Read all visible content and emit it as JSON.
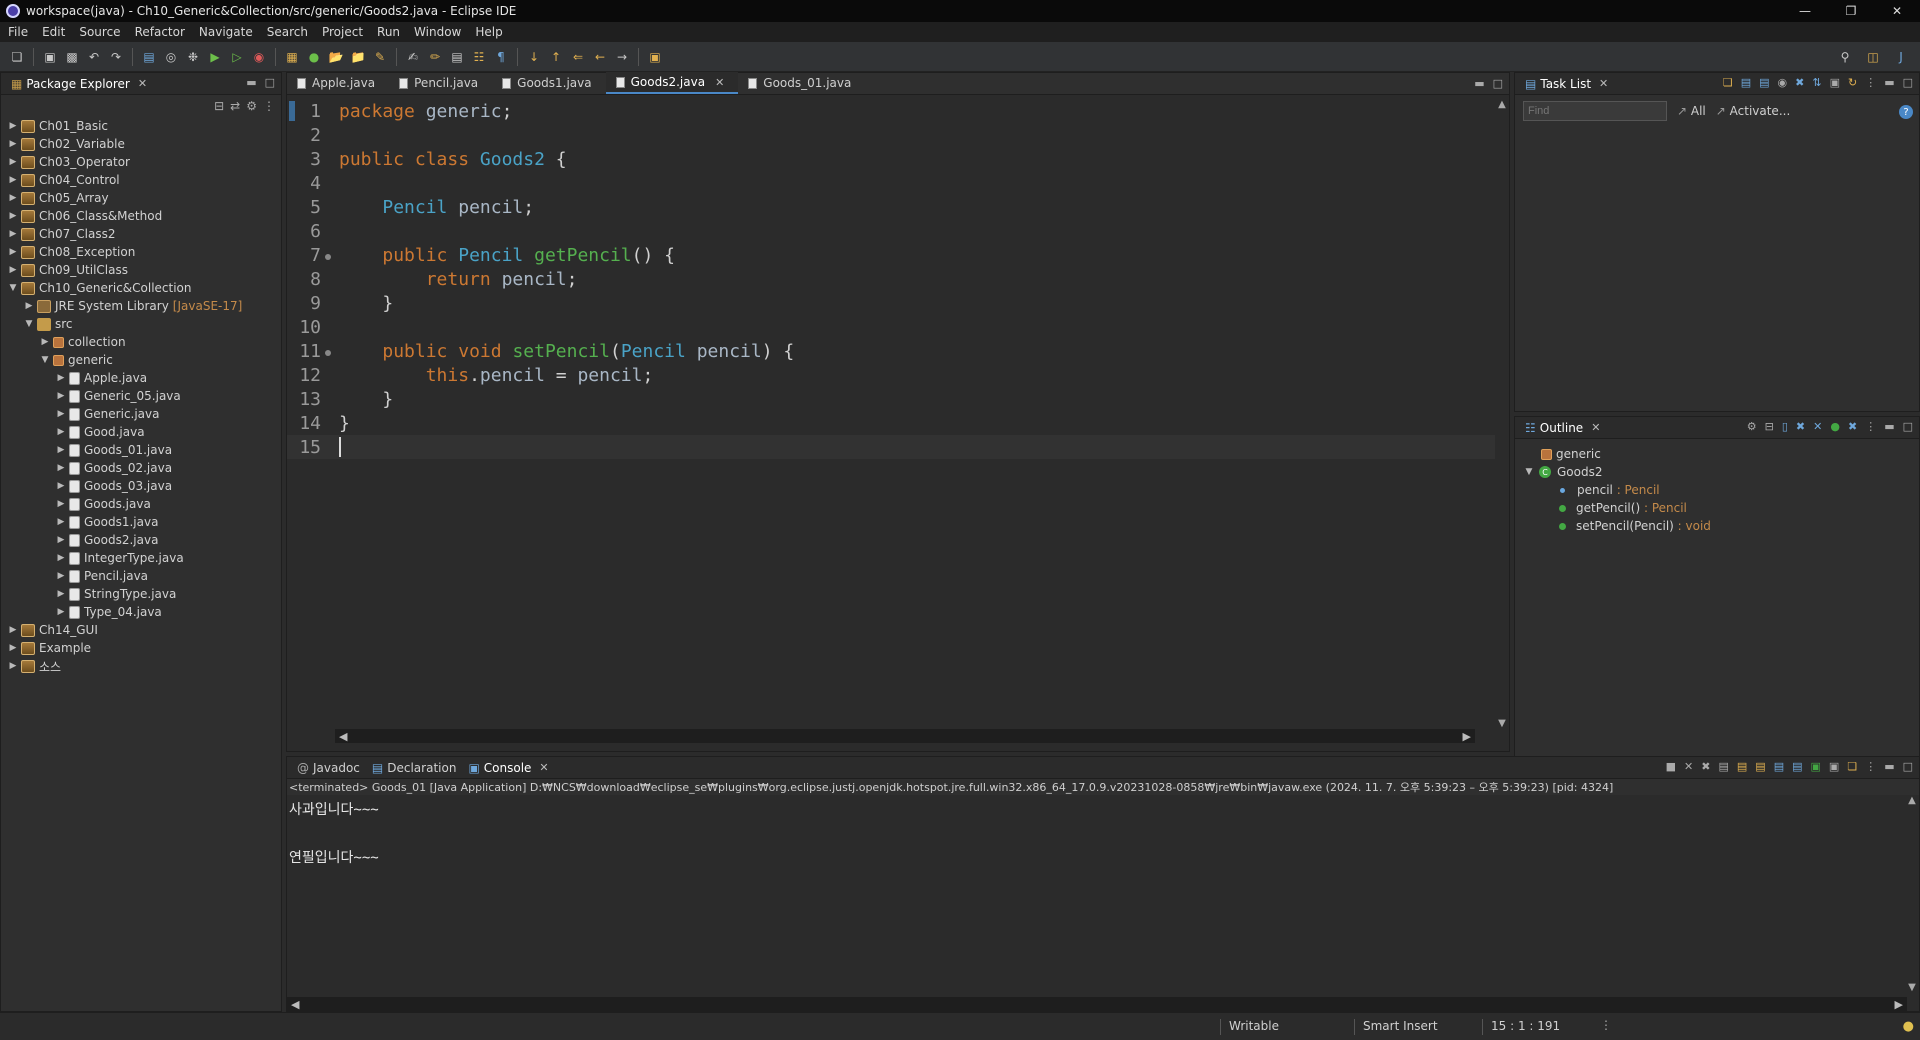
{
  "window": {
    "title": "workspace(java) - Ch10_Generic&Collection/src/generic/Goods2.java - Eclipse IDE"
  },
  "menu": [
    "File",
    "Edit",
    "Source",
    "Refactor",
    "Navigate",
    "Search",
    "Project",
    "Run",
    "Window",
    "Help"
  ],
  "package_explorer": {
    "title": "Package Explorer",
    "items": [
      {
        "label": "Ch01_Basic",
        "icon": "project",
        "depth": 0,
        "twisty": "closed"
      },
      {
        "label": "Ch02_Variable",
        "icon": "project",
        "depth": 0,
        "twisty": "closed"
      },
      {
        "label": "Ch03_Operator",
        "icon": "project",
        "depth": 0,
        "twisty": "closed"
      },
      {
        "label": "Ch04_Control",
        "icon": "project",
        "depth": 0,
        "twisty": "closed"
      },
      {
        "label": "Ch05_Array",
        "icon": "project",
        "depth": 0,
        "twisty": "closed"
      },
      {
        "label": "Ch06_Class&Method",
        "icon": "project",
        "depth": 0,
        "twisty": "closed"
      },
      {
        "label": "Ch07_Class2",
        "icon": "project",
        "depth": 0,
        "twisty": "closed"
      },
      {
        "label": "Ch08_Exception",
        "icon": "project",
        "depth": 0,
        "twisty": "closed"
      },
      {
        "label": "Ch09_UtilClass",
        "icon": "project",
        "depth": 0,
        "twisty": "closed"
      },
      {
        "label": "Ch10_Generic&Collection",
        "icon": "project",
        "depth": 0,
        "twisty": "open"
      },
      {
        "label": "JRE System Library",
        "tag": "[JavaSE-17]",
        "icon": "jre",
        "depth": 1,
        "twisty": "closed"
      },
      {
        "label": "src",
        "icon": "folder",
        "depth": 1,
        "twisty": "open"
      },
      {
        "label": "collection",
        "icon": "package",
        "depth": 2,
        "twisty": "closed"
      },
      {
        "label": "generic",
        "icon": "package",
        "depth": 2,
        "twisty": "open"
      },
      {
        "label": "Apple.java",
        "icon": "java",
        "depth": 3,
        "twisty": "closed"
      },
      {
        "label": "Generic_05.java",
        "icon": "java",
        "depth": 3,
        "twisty": "closed"
      },
      {
        "label": "Generic.java",
        "icon": "java",
        "depth": 3,
        "twisty": "closed"
      },
      {
        "label": "Good.java",
        "icon": "java",
        "depth": 3,
        "twisty": "closed"
      },
      {
        "label": "Goods_01.java",
        "icon": "java",
        "depth": 3,
        "twisty": "closed"
      },
      {
        "label": "Goods_02.java",
        "icon": "java",
        "depth": 3,
        "twisty": "closed"
      },
      {
        "label": "Goods_03.java",
        "icon": "java",
        "depth": 3,
        "twisty": "closed"
      },
      {
        "label": "Goods.java",
        "icon": "java",
        "depth": 3,
        "twisty": "closed"
      },
      {
        "label": "Goods1.java",
        "icon": "java",
        "depth": 3,
        "twisty": "closed"
      },
      {
        "label": "Goods2.java",
        "icon": "java",
        "depth": 3,
        "twisty": "closed"
      },
      {
        "label": "IntegerType.java",
        "icon": "java",
        "depth": 3,
        "twisty": "closed"
      },
      {
        "label": "Pencil.java",
        "icon": "java",
        "depth": 3,
        "twisty": "closed"
      },
      {
        "label": "StringType.java",
        "icon": "java",
        "depth": 3,
        "twisty": "closed"
      },
      {
        "label": "Type_04.java",
        "icon": "java",
        "depth": 3,
        "twisty": "closed"
      },
      {
        "label": "Ch14_GUI",
        "icon": "project",
        "depth": 0,
        "twisty": "closed"
      },
      {
        "label": "Example",
        "icon": "project",
        "depth": 0,
        "twisty": "closed"
      },
      {
        "label": "소스",
        "icon": "project",
        "depth": 0,
        "twisty": "closed"
      }
    ]
  },
  "editor": {
    "tabs": [
      {
        "label": "Apple.java",
        "active": false
      },
      {
        "label": "Pencil.java",
        "active": false
      },
      {
        "label": "Goods1.java",
        "active": false
      },
      {
        "label": "Goods2.java",
        "active": true
      },
      {
        "label": "Goods_01.java",
        "active": false
      }
    ],
    "lines": [
      [
        [
          "kw",
          "package"
        ],
        [
          "pl",
          " "
        ],
        [
          "id",
          "generic"
        ],
        [
          "pl",
          ";"
        ]
      ],
      [],
      [
        [
          "kw",
          "public"
        ],
        [
          "pl",
          " "
        ],
        [
          "kw",
          "class"
        ],
        [
          "pl",
          " "
        ],
        [
          "ty",
          "Goods2"
        ],
        [
          "pl",
          " {"
        ]
      ],
      [],
      [
        [
          "pl",
          "    "
        ],
        [
          "ty",
          "Pencil"
        ],
        [
          "pl",
          " "
        ],
        [
          "id",
          "pencil"
        ],
        [
          "pl",
          ";"
        ]
      ],
      [],
      [
        [
          "pl",
          "    "
        ],
        [
          "kw",
          "public"
        ],
        [
          "pl",
          " "
        ],
        [
          "ty",
          "Pencil"
        ],
        [
          "pl",
          " "
        ],
        [
          "fn",
          "getPencil"
        ],
        [
          "pl",
          "() {"
        ]
      ],
      [
        [
          "pl",
          "        "
        ],
        [
          "kw",
          "return"
        ],
        [
          "pl",
          " "
        ],
        [
          "id",
          "pencil"
        ],
        [
          "pl",
          ";"
        ]
      ],
      [
        [
          "pl",
          "    }"
        ]
      ],
      [],
      [
        [
          "pl",
          "    "
        ],
        [
          "kw",
          "public"
        ],
        [
          "pl",
          " "
        ],
        [
          "kw",
          "void"
        ],
        [
          "pl",
          " "
        ],
        [
          "fn",
          "setPencil"
        ],
        [
          "pl",
          "("
        ],
        [
          "ty",
          "Pencil"
        ],
        [
          "pl",
          " "
        ],
        [
          "id",
          "pencil"
        ],
        [
          "pl",
          ") {"
        ]
      ],
      [
        [
          "pl",
          "        "
        ],
        [
          "kw",
          "this"
        ],
        [
          "pl",
          "."
        ],
        [
          "id",
          "pencil"
        ],
        [
          "pl",
          " = "
        ],
        [
          "id",
          "pencil"
        ],
        [
          "pl",
          ";"
        ]
      ],
      [
        [
          "pl",
          "    }"
        ]
      ],
      [
        [
          "pl",
          "}"
        ]
      ],
      []
    ],
    "fold_lines": [
      7,
      11
    ],
    "current_line": 15
  },
  "task_list": {
    "title": "Task List",
    "find_placeholder": "Find",
    "all_label": "All",
    "activate_label": "Activate..."
  },
  "outline": {
    "title": "Outline",
    "package": "generic",
    "class": "Goods2",
    "members": [
      {
        "name": "pencil",
        "type": "Pencil",
        "kind": "field"
      },
      {
        "name": "getPencil()",
        "type": "Pencil",
        "kind": "method"
      },
      {
        "name": "setPencil(Pencil)",
        "type": "void",
        "kind": "method"
      }
    ]
  },
  "console": {
    "tabs": [
      {
        "label": "Javadoc",
        "active": false
      },
      {
        "label": "Declaration",
        "active": false
      },
      {
        "label": "Console",
        "active": true
      }
    ],
    "launch_info": "<terminated> Goods_01 [Java Application] D:₩NCS₩download₩eclipse_se₩plugins₩org.eclipse.justj.openjdk.hotspot.jre.full.win32.x86_64_17.0.9.v20231028-0858₩jre₩bin₩javaw.exe  (2024. 11. 7. 오후 5:39:23 – 오후 5:39:23) [pid: 4324]",
    "output": [
      "사과입니다~~~",
      "",
      "연필입니다~~~"
    ]
  },
  "status": {
    "writable": "Writable",
    "insert_mode": "Smart Insert",
    "position": "15 : 1 : 191"
  }
}
